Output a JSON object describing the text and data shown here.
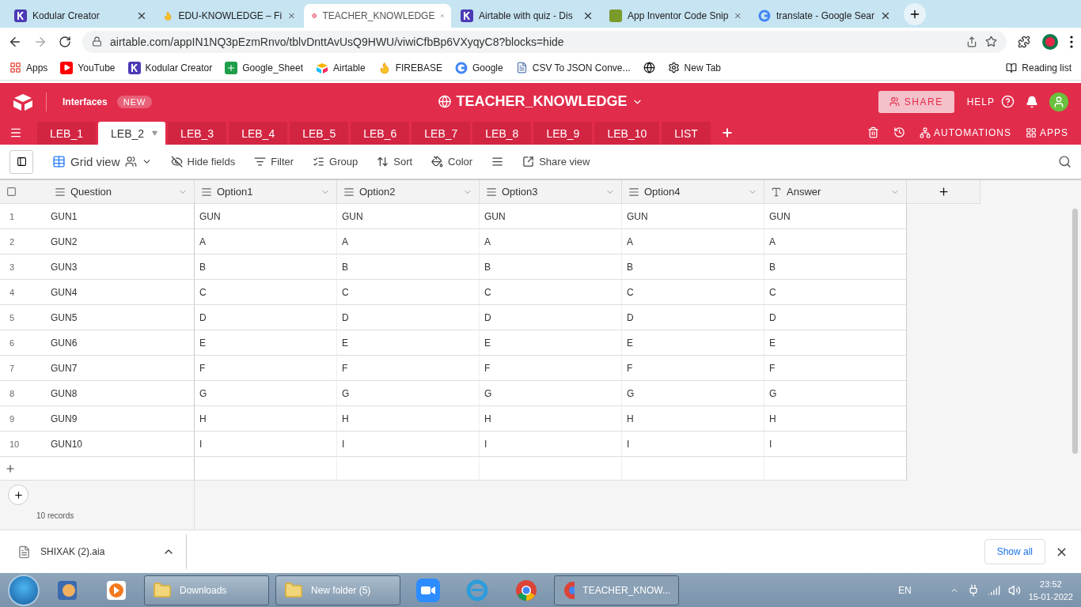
{
  "browser": {
    "tabs": [
      {
        "title": "Kodular Creator",
        "selected": false
      },
      {
        "title": "EDU-KNOWLEDGE – Fi",
        "selected": false
      },
      {
        "title": "TEACHER_KNOWLEDGE",
        "selected": true
      },
      {
        "title": "Airtable with quiz - Dis",
        "selected": false
      },
      {
        "title": "App Inventor Code Snip",
        "selected": false
      },
      {
        "title": "translate - Google Sear",
        "selected": false
      }
    ],
    "address": "airtable.com/appIN1NQ3pEzmRnvo/tblvDnttAvUsQ9HWU/viwiCfbBp6VXyqyC8?blocks=hide",
    "bookmarks": [
      {
        "label": "Apps"
      },
      {
        "label": "YouTube"
      },
      {
        "label": "Kodular Creator"
      },
      {
        "label": "Google_Sheet"
      },
      {
        "label": "Airtable"
      },
      {
        "label": "FIREBASE"
      },
      {
        "label": "Google"
      },
      {
        "label": "CSV To JSON Conve..."
      },
      {
        "label": "New Tab"
      }
    ],
    "reading_list": "Reading list"
  },
  "app": {
    "interfaces": "Interfaces",
    "badge": "NEW",
    "base_title": "TEACHER_KNOWLEDGE",
    "share": "SHARE",
    "help": "HELP",
    "table_tabs": [
      {
        "label": "LEB_1",
        "selected": false
      },
      {
        "label": "LEB_2",
        "selected": true
      },
      {
        "label": "LEB_3",
        "selected": false
      },
      {
        "label": "LEB_4",
        "selected": false
      },
      {
        "label": "LEB_5",
        "selected": false
      },
      {
        "label": "LEB_6",
        "selected": false
      },
      {
        "label": "LEB_7",
        "selected": false
      },
      {
        "label": "LEB_8",
        "selected": false
      },
      {
        "label": "LEB_9",
        "selected": false
      },
      {
        "label": "LEB_10",
        "selected": false
      },
      {
        "label": "LIST",
        "selected": false
      }
    ],
    "automations": "AUTOMATIONS",
    "apps": "APPS",
    "view_name": "Grid view",
    "toolbar": [
      {
        "label": "Hide fields"
      },
      {
        "label": "Filter"
      },
      {
        "label": "Group"
      },
      {
        "label": "Sort"
      },
      {
        "label": "Color"
      },
      {
        "label": "Share view"
      }
    ]
  },
  "table": {
    "all_checked": false,
    "columns": [
      {
        "name": "Question",
        "kind": "text"
      },
      {
        "name": "Option1",
        "kind": "text"
      },
      {
        "name": "Option2",
        "kind": "text"
      },
      {
        "name": "Option3",
        "kind": "text"
      },
      {
        "name": "Option4",
        "kind": "text"
      },
      {
        "name": "Answer",
        "kind": "letter"
      }
    ],
    "rows": [
      {
        "num": "1",
        "cells": [
          "GUN1",
          "GUN",
          "GUN",
          "GUN",
          "GUN",
          "GUN"
        ]
      },
      {
        "num": "2",
        "cells": [
          "GUN2",
          "A",
          "A",
          "A",
          "A",
          "A"
        ]
      },
      {
        "num": "3",
        "cells": [
          "GUN3",
          "B",
          "B",
          "B",
          "B",
          "B"
        ]
      },
      {
        "num": "4",
        "cells": [
          "GUN4",
          "C",
          "C",
          "C",
          "C",
          "C"
        ]
      },
      {
        "num": "5",
        "cells": [
          "GUN5",
          "D",
          "D",
          "D",
          "D",
          "D"
        ]
      },
      {
        "num": "6",
        "cells": [
          "GUN6",
          "E",
          "E",
          "E",
          "E",
          "E"
        ]
      },
      {
        "num": "7",
        "cells": [
          "GUN7",
          "F",
          "F",
          "F",
          "F",
          "F"
        ]
      },
      {
        "num": "8",
        "cells": [
          "GUN8",
          "G",
          "G",
          "G",
          "G",
          "G"
        ]
      },
      {
        "num": "9",
        "cells": [
          "GUN9",
          "H",
          "H",
          "H",
          "H",
          "H"
        ]
      },
      {
        "num": "10",
        "cells": [
          "GUN10",
          "I",
          "I",
          "I",
          "I",
          "I"
        ]
      }
    ],
    "record_count": "10 records"
  },
  "downloads": {
    "file": "SHIXAK (2).aia",
    "show_all": "Show all"
  },
  "taskbar": {
    "windows": [
      {
        "label": "Downloads",
        "kind": "folder"
      },
      {
        "label": "New folder (5)",
        "kind": "folder"
      },
      {
        "label": "TEACHER_KNOW...",
        "kind": "chrome"
      }
    ],
    "language": "EN",
    "time": "23:52",
    "date": "15-01-2022"
  }
}
